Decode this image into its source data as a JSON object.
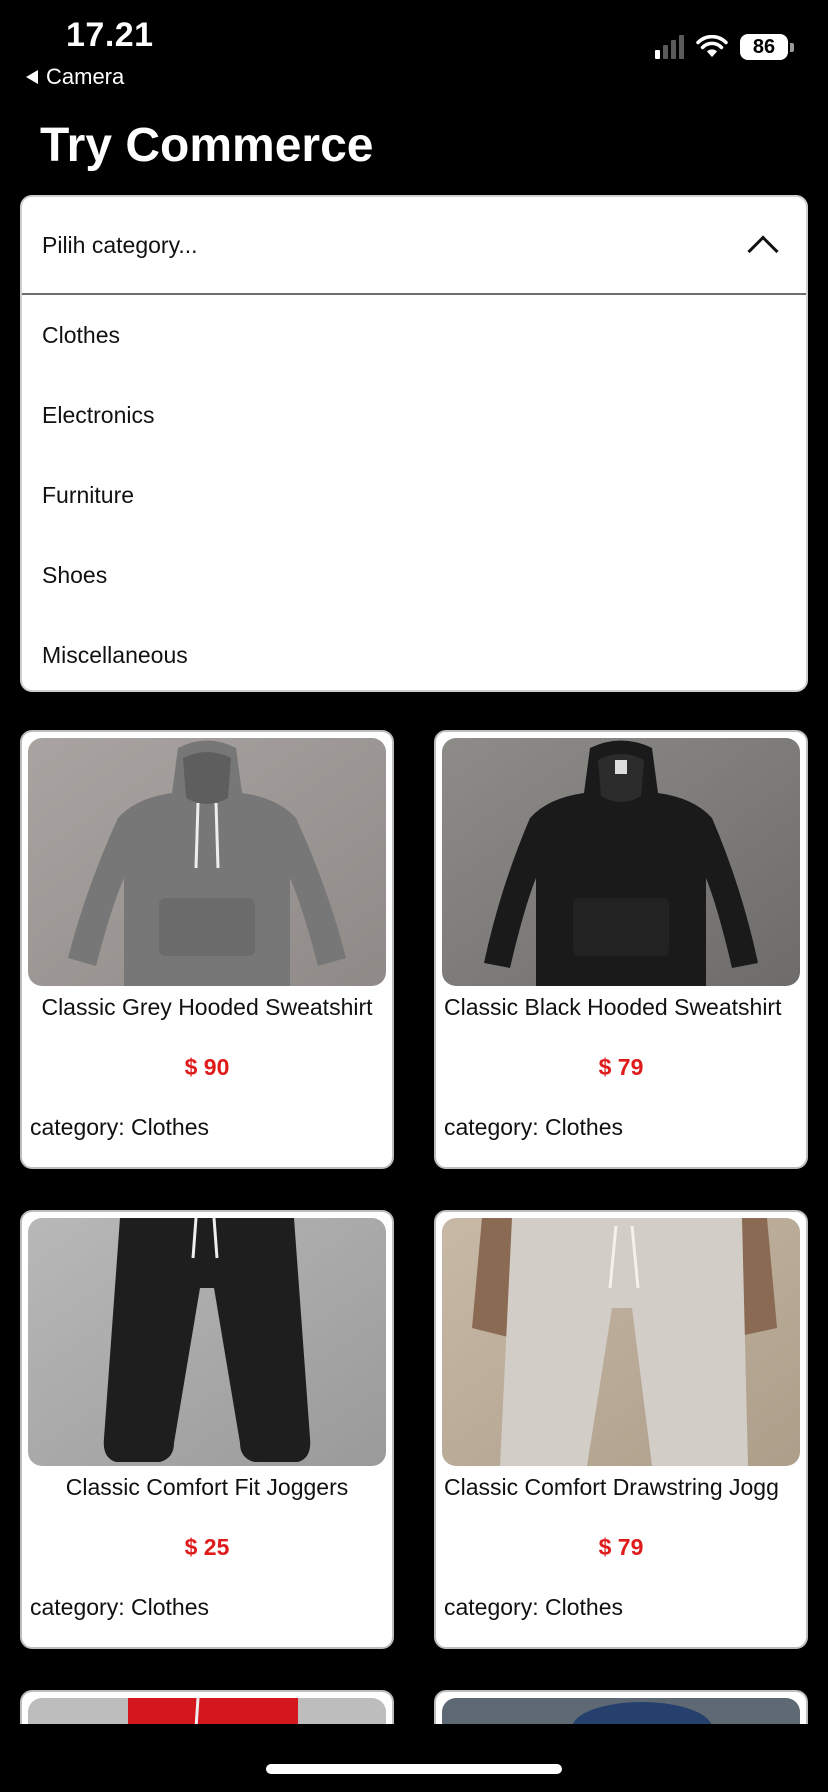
{
  "status": {
    "time": "17.21",
    "back_label": "Camera",
    "battery": "86"
  },
  "header": {
    "title": "Try Commerce"
  },
  "dropdown": {
    "placeholder": "Pilih category...",
    "options": [
      "Clothes",
      "Electronics",
      "Furniture",
      "Shoes",
      "Miscellaneous"
    ]
  },
  "products": [
    {
      "title": "Classic Grey Hooded Sweatshirt",
      "price": "$ 90",
      "category": "category: Clothes"
    },
    {
      "title": "Classic Black Hooded Sweatshirt",
      "price": "$ 79",
      "category": "category: Clothes"
    },
    {
      "title": "Classic Comfort Fit Joggers",
      "price": "$ 25",
      "category": "category: Clothes"
    },
    {
      "title": "Classic Comfort Drawstring Jogg",
      "price": "$ 79",
      "category": "category: Clothes"
    }
  ],
  "colors": {
    "background": "#000000",
    "price": "#e01b1b",
    "card": "#ffffff"
  }
}
